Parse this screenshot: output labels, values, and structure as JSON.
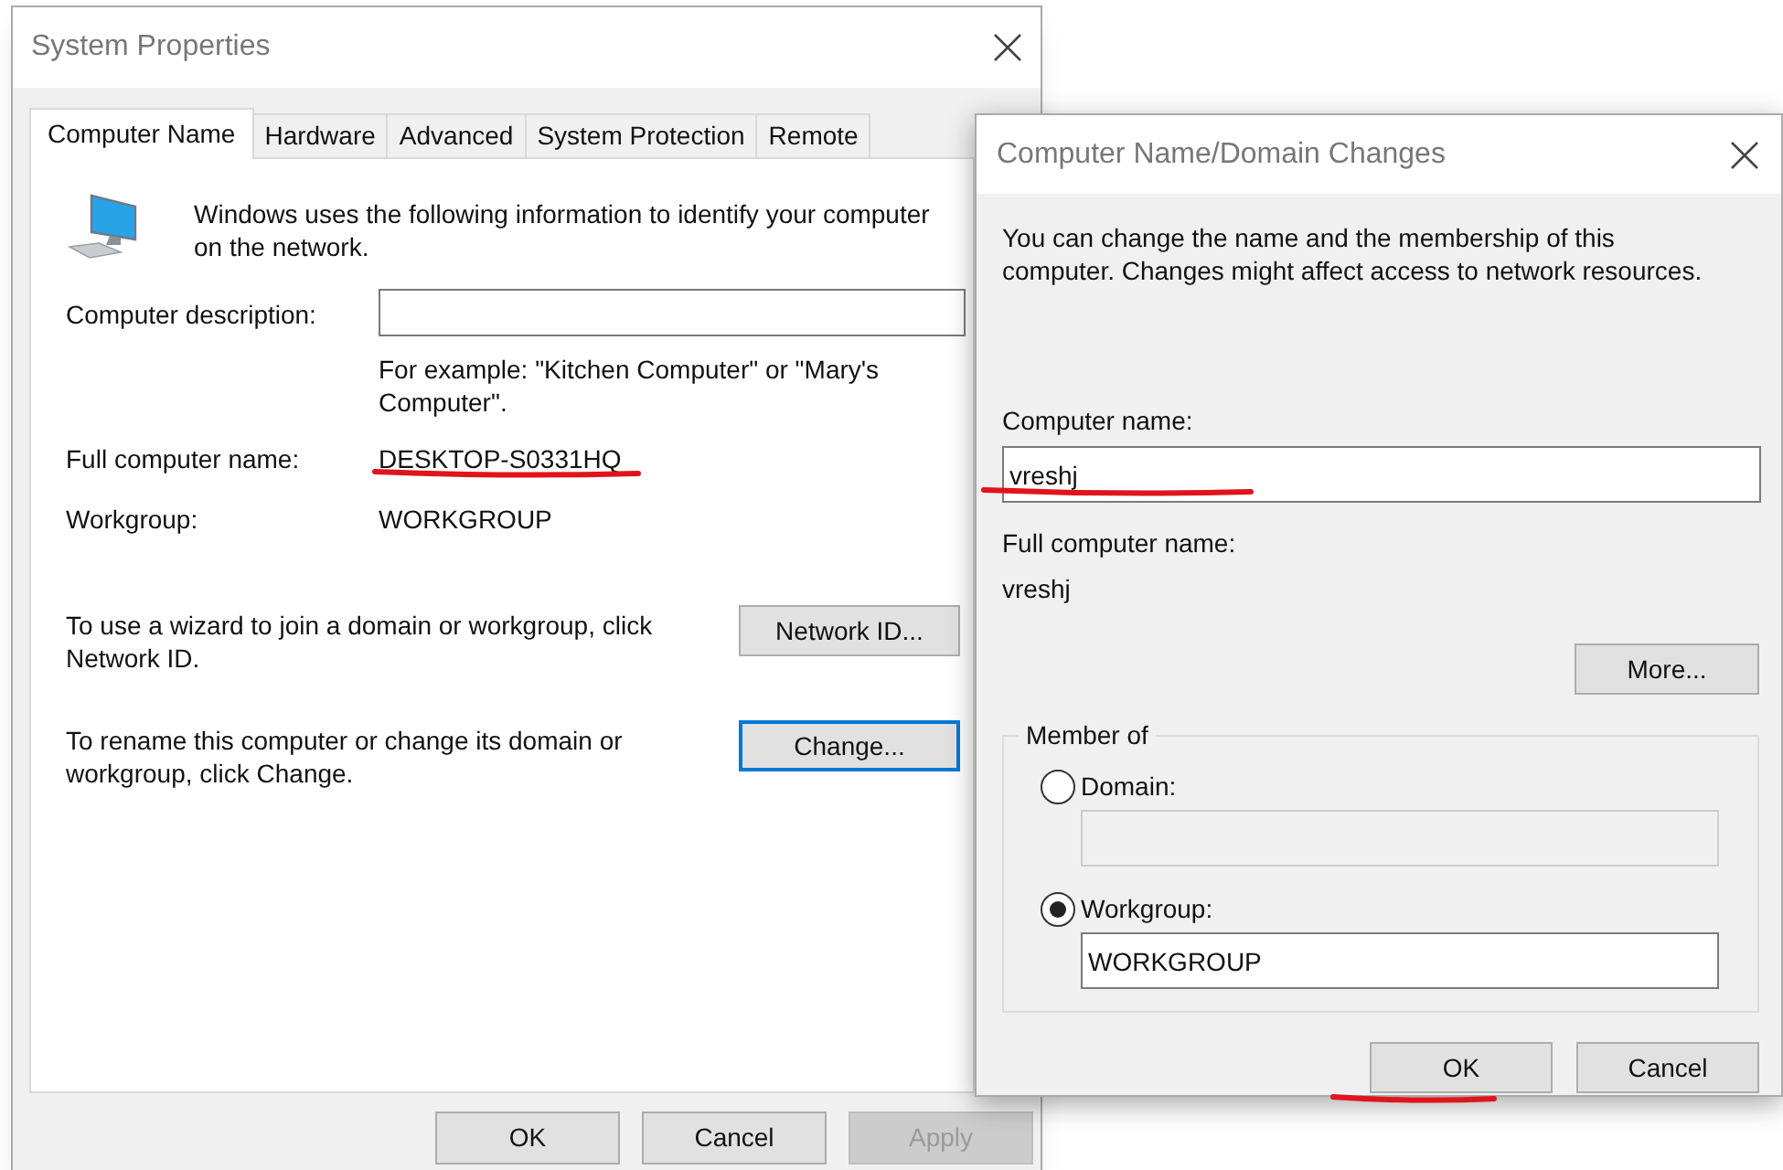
{
  "system_properties": {
    "title": "System Properties",
    "tabs": [
      {
        "label": "Computer Name",
        "selected": true
      },
      {
        "label": "Hardware",
        "selected": false
      },
      {
        "label": "Advanced",
        "selected": false
      },
      {
        "label": "System Protection",
        "selected": false
      },
      {
        "label": "Remote",
        "selected": false
      }
    ],
    "intro": "Windows uses the following information to identify your computer on the network.",
    "fields": [
      {
        "kind": "input",
        "label": "Computer description:",
        "hint": "For example: \"Kitchen Computer\" or \"Mary's Computer\"."
      },
      {
        "kind": "text",
        "label": "Full computer name:",
        "value": "DESKTOP-S0331HQ",
        "highlighted": true
      },
      {
        "kind": "text",
        "label": "Workgroup:",
        "value": "WORKGROUP",
        "highlighted": false
      }
    ],
    "actions": [
      {
        "text": "To use a wizard to join a domain or workgroup, click Network ID.",
        "button": "Network ID...",
        "focused": false
      },
      {
        "text": "To rename this computer or change its domain or workgroup, click Change.",
        "button": "Change...",
        "focused": true
      }
    ],
    "buttons": [
      {
        "label": "OK",
        "disabled": false
      },
      {
        "label": "Cancel",
        "disabled": false
      },
      {
        "label": "Apply",
        "disabled": true
      }
    ]
  },
  "domain_changes": {
    "title": "Computer Name/Domain Changes",
    "intro": "You can change the name and the membership of this computer. Changes might affect access to network resources.",
    "computer_name": {
      "label": "Computer name:",
      "value": "vreshj",
      "highlighted": true
    },
    "full_name": {
      "label": "Full computer name:",
      "value": "vreshj"
    },
    "more_button": "More...",
    "member_of": {
      "legend": "Member of",
      "options": [
        {
          "label": "Domain:",
          "selected": false
        },
        {
          "label": "Workgroup:",
          "selected": true,
          "value": "WORKGROUP"
        }
      ]
    },
    "buttons": [
      {
        "label": "OK",
        "highlighted": true
      },
      {
        "label": "Cancel",
        "highlighted": false
      }
    ]
  }
}
